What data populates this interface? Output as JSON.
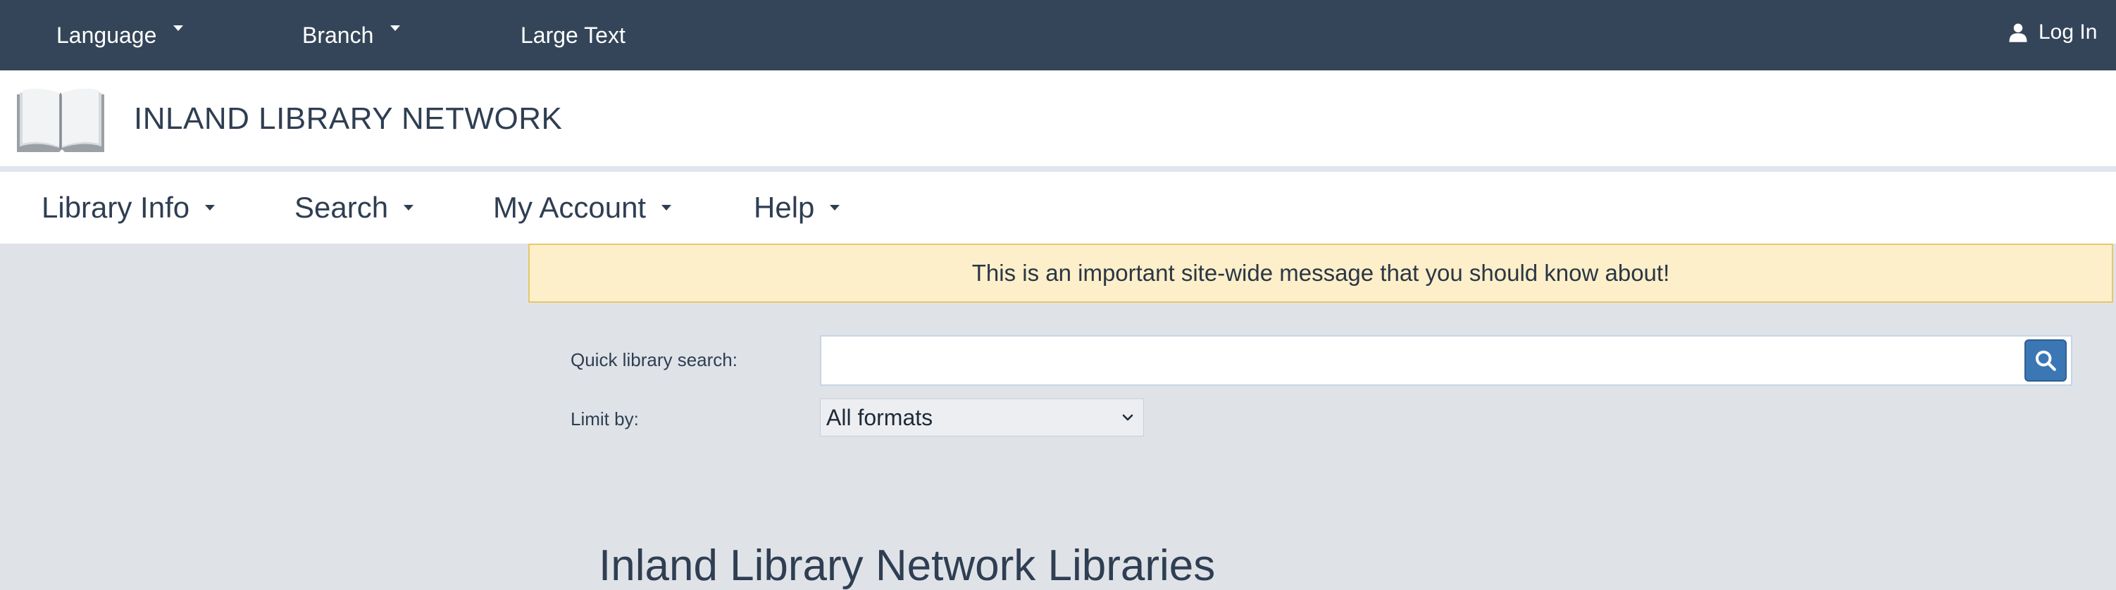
{
  "topbar": {
    "language_label": "Language",
    "branch_label": "Branch",
    "large_text_label": "Large Text",
    "login_label": "Log In"
  },
  "brand": {
    "site_name": "INLAND LIBRARY NETWORK"
  },
  "nav": {
    "items": [
      {
        "label": "Library Info"
      },
      {
        "label": "Search"
      },
      {
        "label": "My Account"
      },
      {
        "label": "Help"
      }
    ]
  },
  "alert": {
    "message": "This is an important site-wide message that you should know about!"
  },
  "search": {
    "quick_label": "Quick library search:",
    "query_value": "",
    "limit_label": "Limit by:",
    "limit_selected": "All formats"
  },
  "main": {
    "heading": "Inland Library Network Libraries"
  },
  "colors": {
    "topbar_bg": "#344559",
    "page_bg": "#dfe3e8",
    "alert_bg": "#fcefc9",
    "accent": "#3b77b5"
  },
  "icons": [
    "caret-down-icon",
    "user-icon",
    "open-book-logo",
    "search-icon",
    "chevron-down-icon"
  ]
}
